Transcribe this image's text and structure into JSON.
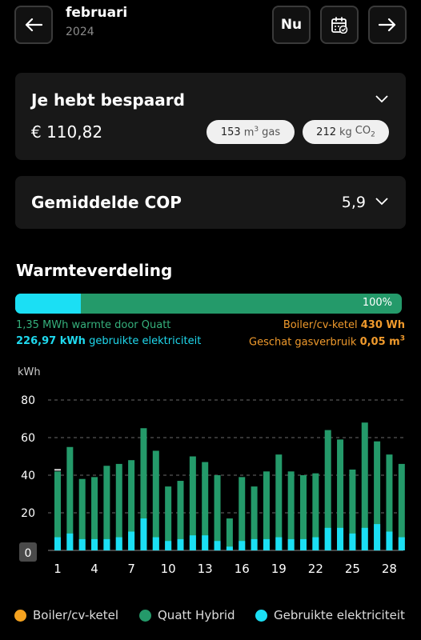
{
  "header": {
    "month": "februari",
    "year": "2024",
    "now_label": "Nu",
    "back_icon": "arrow-left-icon",
    "calendar_icon": "calendar-icon",
    "forward_icon": "arrow-right-icon"
  },
  "savings": {
    "title": "Je hebt bespaard",
    "amount": "€ 110,82",
    "gas_value": "153",
    "gas_unit": "m",
    "gas_unit_sup": "3",
    "gas_label": "gas",
    "co2_value": "212",
    "co2_unit": "kg",
    "co2_label": "CO",
    "co2_sub": "2"
  },
  "cop": {
    "title": "Gemiddelde COP",
    "value": "5,9"
  },
  "heat": {
    "title": "Warmteverdeling",
    "percent_label": "100%",
    "electric_fraction": 0.17,
    "quatt_value": "1,35 MWh",
    "quatt_label": "warmte door Quatt",
    "elec_value": "226,97 kWh",
    "elec_label": "gebruikte elektriciteit",
    "boiler_label": "Boiler/cv-ketel",
    "boiler_value": "430 Wh",
    "gas_est_label": "Geschat gasverbruik",
    "gas_est_value": "0,05 m",
    "gas_est_sup": "3"
  },
  "colors": {
    "quatt": "#249a6a",
    "electric": "#1bdff4",
    "boiler": "#f5a21f",
    "grid": "#6a6a6a"
  },
  "chart_data": {
    "type": "bar",
    "ylabel": "kWh",
    "ylim": [
      0,
      80
    ],
    "yticks": [
      20,
      40,
      60,
      80
    ],
    "zero_label": "0",
    "x_tick_labels": [
      "1",
      "4",
      "7",
      "10",
      "13",
      "16",
      "19",
      "22",
      "25",
      "28"
    ],
    "x": [
      1,
      2,
      3,
      4,
      5,
      6,
      7,
      8,
      9,
      10,
      11,
      12,
      13,
      14,
      15,
      16,
      17,
      18,
      19,
      20,
      21,
      22,
      23,
      24,
      25,
      26,
      27,
      28,
      29
    ],
    "series": [
      {
        "name": "Quatt Hybrid",
        "values": [
          42,
          55,
          38,
          39,
          45,
          46,
          48,
          65,
          53,
          34,
          37,
          50,
          47,
          40,
          17,
          39,
          34,
          42,
          51,
          42,
          40,
          41,
          64,
          59,
          43,
          68,
          58,
          51,
          46
        ]
      },
      {
        "name": "Gebruikte elektriciteit",
        "values": [
          7,
          9,
          6,
          6,
          6,
          7,
          10,
          17,
          7,
          5,
          6,
          8,
          8,
          5,
          2,
          5,
          6,
          6,
          7,
          6,
          6,
          7,
          12,
          12,
          9,
          12,
          14,
          10,
          7
        ]
      },
      {
        "name": "Boiler/cv-ketel",
        "values": [
          0.4,
          0,
          0,
          0,
          0,
          0,
          0,
          0,
          0,
          0,
          0,
          0,
          0,
          0,
          0,
          0,
          0,
          0,
          0,
          0,
          0,
          0,
          0,
          0,
          0,
          0,
          0,
          0,
          0
        ]
      }
    ]
  },
  "legend": {
    "boiler": "Boiler/cv-ketel",
    "quatt": "Quatt Hybrid",
    "elec": "Gebruikte elektriciteit"
  }
}
